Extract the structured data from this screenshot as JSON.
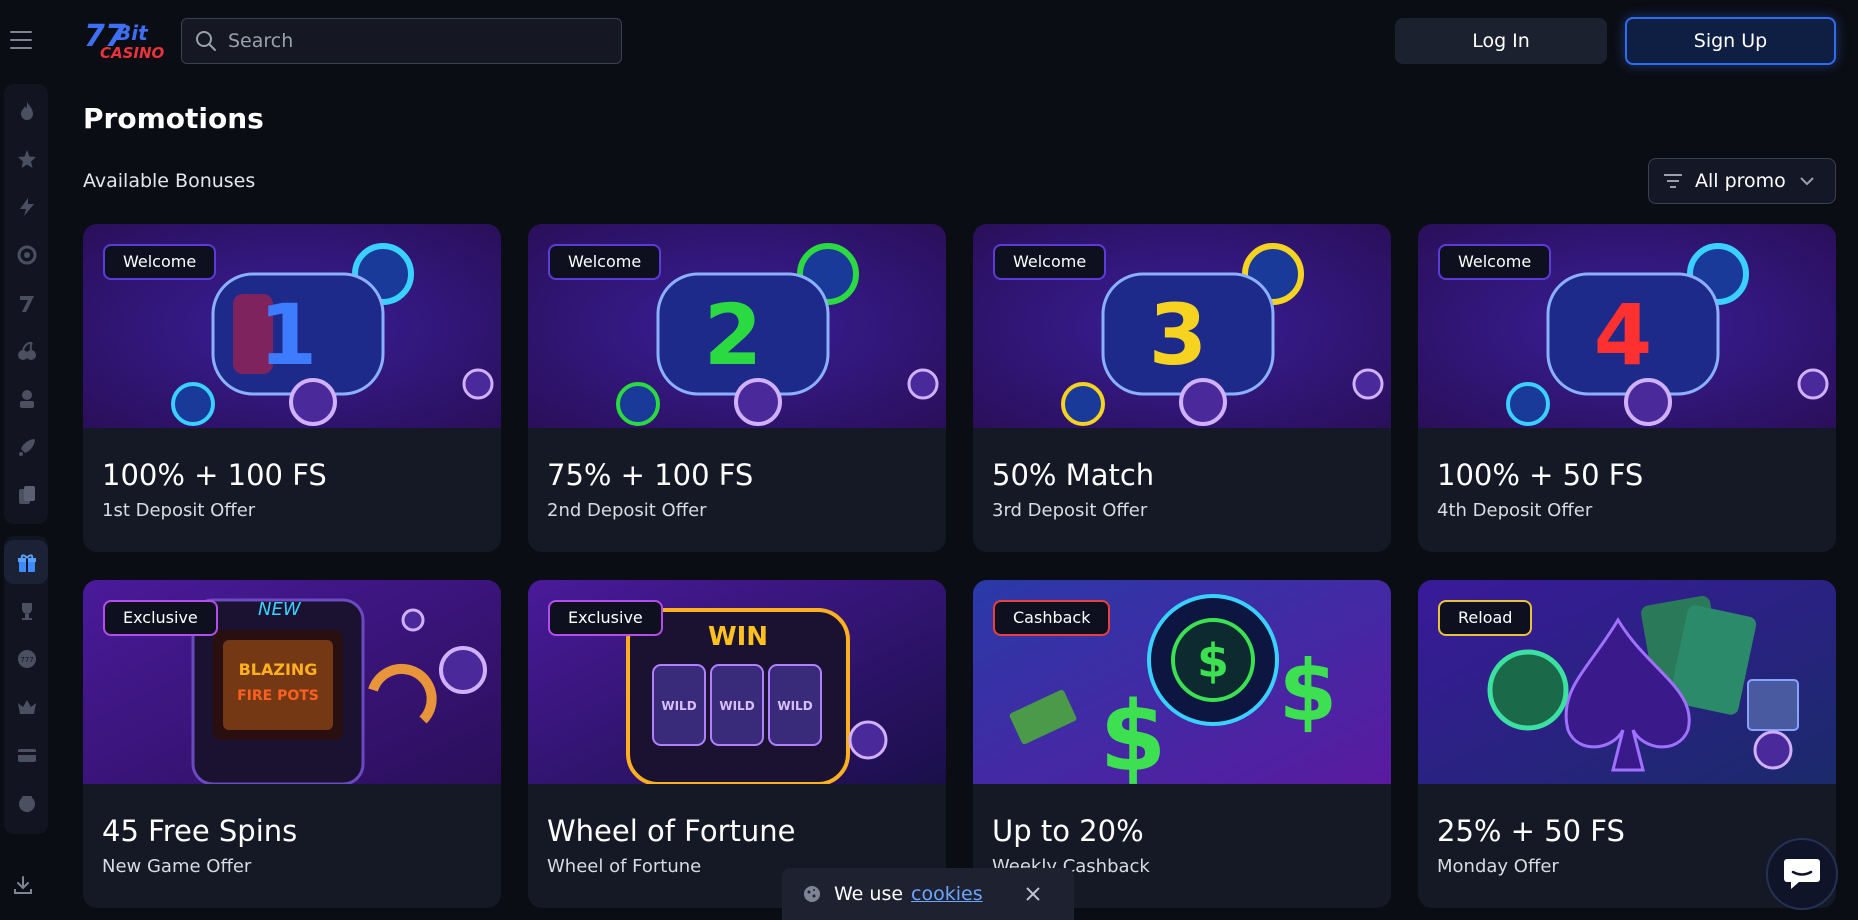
{
  "header": {
    "logo_text": "7Bit CASINO",
    "search_placeholder": "Search",
    "login_label": "Log In",
    "signup_label": "Sign Up"
  },
  "sidebar": {
    "items": [
      {
        "icon": "fire-icon"
      },
      {
        "icon": "stars-icon"
      },
      {
        "icon": "lightning-icon"
      },
      {
        "icon": "target-icon"
      },
      {
        "icon": "slot-seven-icon"
      },
      {
        "icon": "cherries-icon"
      },
      {
        "icon": "dealer-icon"
      },
      {
        "icon": "rocket-icon"
      },
      {
        "icon": "cards-icon"
      },
      {
        "icon": "gift-icon",
        "active": true
      },
      {
        "icon": "trophy-icon"
      },
      {
        "icon": "lottery-777-icon"
      },
      {
        "icon": "crown-icon"
      },
      {
        "icon": "payment-card-icon"
      },
      {
        "icon": "vip-icon"
      },
      {
        "icon": "download-icon"
      }
    ]
  },
  "page": {
    "title": "Promotions",
    "subtitle": "Available Bonuses",
    "filter_label": "All promo"
  },
  "promos": [
    {
      "badge": "Welcome",
      "title": "100% + 100 FS",
      "subtitle": "1st Deposit Offer",
      "accent": "#3d7bff"
    },
    {
      "badge": "Welcome",
      "title": "75% + 100 FS",
      "subtitle": "2nd Deposit Offer",
      "accent": "#2bd940"
    },
    {
      "badge": "Welcome",
      "title": "50% Match",
      "subtitle": "3rd Deposit Offer",
      "accent": "#f5d320"
    },
    {
      "badge": "Welcome",
      "title": "100% + 50 FS",
      "subtitle": "4th Deposit Offer",
      "accent": "#ff3030"
    },
    {
      "badge": "Exclusive",
      "title": "45 Free Spins",
      "subtitle": "New Game Offer",
      "accent": "#ff8a1c"
    },
    {
      "badge": "Exclusive",
      "title": "Wheel of Fortune",
      "subtitle": "Wheel of Fortune",
      "accent": "#ffb020"
    },
    {
      "badge": "Cashback",
      "title": "Up to 20%",
      "subtitle": "Weekly Cashback",
      "accent": "#3ce050"
    },
    {
      "badge": "Reload",
      "title": "25% + 50 FS",
      "subtitle": "Monday Offer",
      "accent": "#7a3cf0"
    }
  ],
  "cookie": {
    "text": "We use",
    "link": "cookies"
  },
  "colors": {
    "background": "#0b0d14",
    "card": "#151925",
    "signup_border": "#2f6cf0"
  }
}
